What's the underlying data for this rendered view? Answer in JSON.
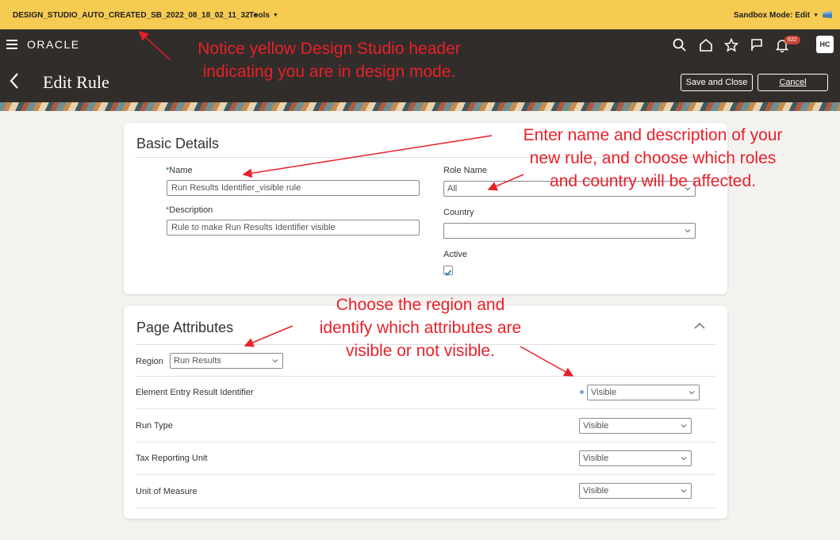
{
  "sandbox_bar": {
    "sandbox_name": "DESIGN_STUDIO_AUTO_CREATED_SB_2022_08_18_02_11_32",
    "tools_label": "Tools",
    "mode_label": "Sandbox Mode: Edit"
  },
  "header": {
    "logo": "ORACLE",
    "notification_count": "622",
    "user_initials": "HC",
    "page_title": "Edit Rule",
    "save_close_label": "Save and Close",
    "cancel_label": "Cancel"
  },
  "basic_details": {
    "title": "Basic Details",
    "name_label": "Name",
    "name_value": "Run Results Identifier_visible rule",
    "description_label": "Description",
    "description_value": "Rule to make Run Results Identifier visible",
    "role_label": "Role Name",
    "role_value": "All",
    "country_label": "Country",
    "country_value": "",
    "active_label": "Active",
    "active_checked": true
  },
  "page_attributes": {
    "title": "Page Attributes",
    "region_label": "Region",
    "region_value": "Run Results",
    "rows": [
      {
        "label": "Element Entry Result Identifier",
        "value": "Visible"
      },
      {
        "label": "Run Type",
        "value": "Visible"
      },
      {
        "label": "Tax Reporting Unit",
        "value": "Visible"
      },
      {
        "label": "Unit of Measure",
        "value": "Visible"
      }
    ]
  },
  "annotations": {
    "header_note_line1": "Notice yellow Design Studio header",
    "header_note_line2": "indicating you are in design mode.",
    "basic_note_line1": "Enter name and description of your",
    "basic_note_line2": "new rule, and choose which roles",
    "basic_note_line3": "and country will be affected.",
    "attrs_note_line1": "Choose the region and",
    "attrs_note_line2": "identify which attributes are",
    "attrs_note_line3": "visible or not visible."
  },
  "colors": {
    "sandbox_bar": "#f6cb52",
    "header": "#312d2a",
    "annotation": "#e8202a",
    "badge": "#c74634"
  }
}
